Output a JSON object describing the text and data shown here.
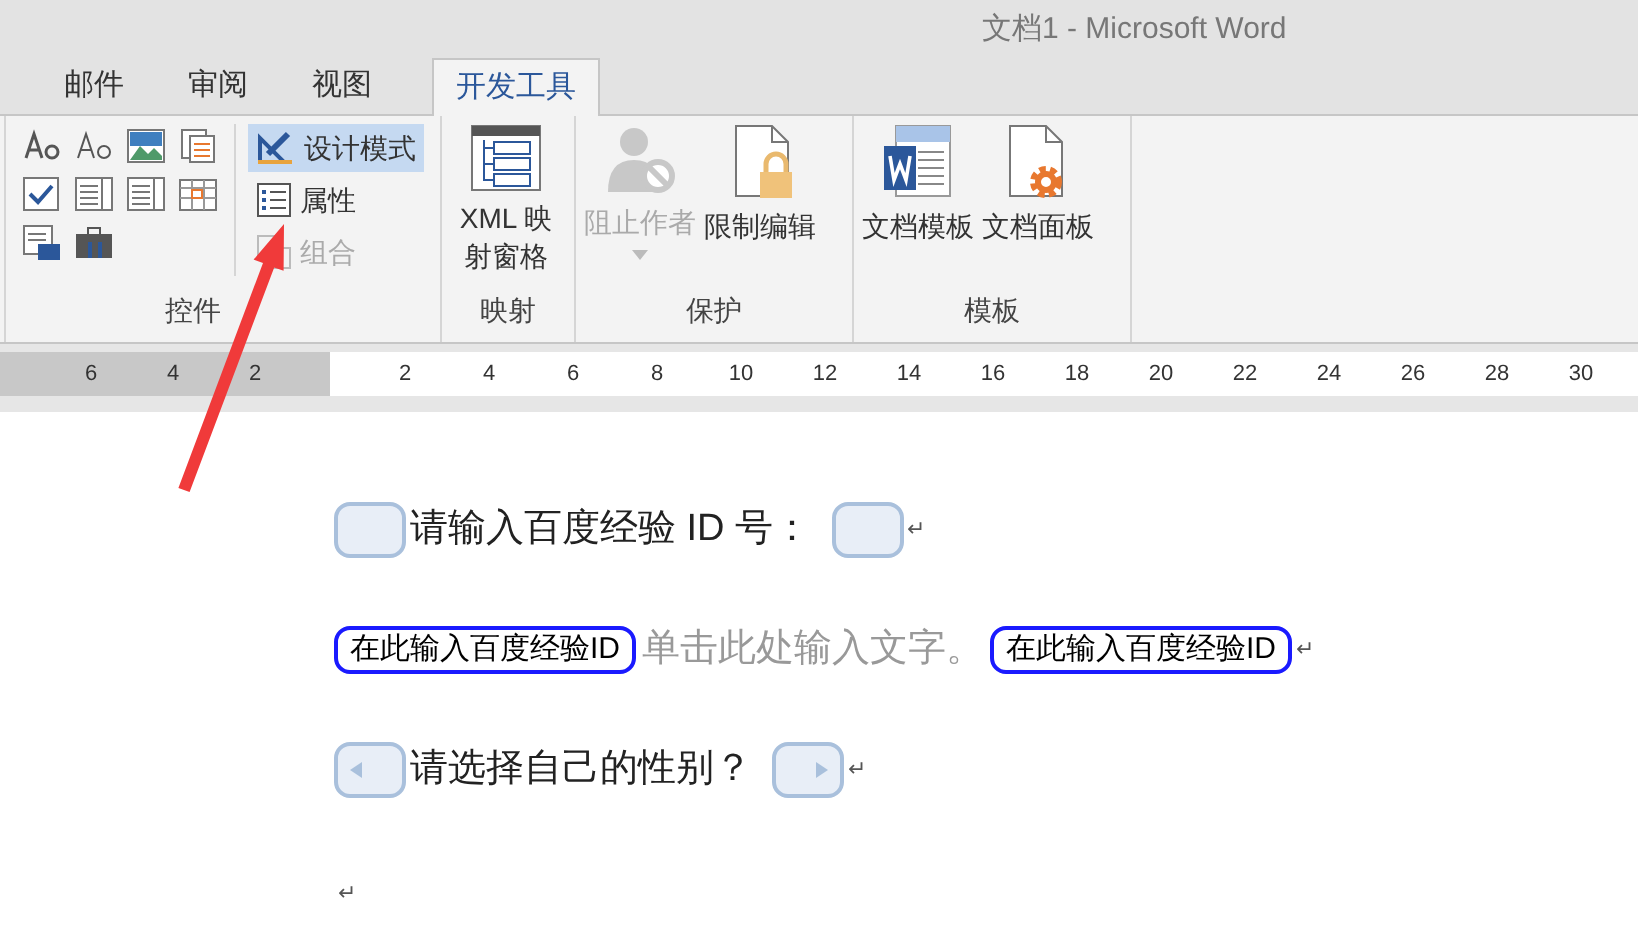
{
  "window": {
    "title": "文档1 - Microsoft Word"
  },
  "tabs": [
    {
      "label": "邮件",
      "selected": false
    },
    {
      "label": "审阅",
      "selected": false
    },
    {
      "label": "视图",
      "selected": false
    },
    {
      "label": "开发工具",
      "selected": true
    }
  ],
  "ribbon": {
    "groups": [
      {
        "label": "控件",
        "items": [
          {
            "label": "设计模式",
            "selected": true,
            "disabled": false
          },
          {
            "label": "属性",
            "selected": false,
            "disabled": false
          },
          {
            "label": "组合",
            "selected": false,
            "disabled": true
          }
        ]
      },
      {
        "label": "映射",
        "items": [
          {
            "label": "XML 映射窗格",
            "disabled": false
          }
        ]
      },
      {
        "label": "保护",
        "items": [
          {
            "label": "阻止作者",
            "disabled": true
          },
          {
            "label": "限制编辑",
            "disabled": false
          }
        ]
      },
      {
        "label": "模板",
        "items": [
          {
            "label": "文档模板",
            "disabled": false
          },
          {
            "label": "文档面板",
            "disabled": false
          }
        ]
      }
    ]
  },
  "ruler": {
    "left_numbers": [
      "6",
      "4",
      "2"
    ],
    "right_numbers": [
      "2",
      "4",
      "6",
      "8",
      "10",
      "12",
      "14",
      "16",
      "18",
      "20",
      "22",
      "24",
      "26",
      "28",
      "30"
    ]
  },
  "document": {
    "paragraphs": [
      {
        "kind": "tagged",
        "text": "请输入百度经验 ID 号：",
        "mark": "↵"
      },
      {
        "kind": "content-control",
        "start_tag": "在此输入百度经验ID",
        "placeholder": "单击此处输入文字。",
        "end_tag": "在此输入百度经验ID",
        "mark": "↵"
      },
      {
        "kind": "tagged-arrows",
        "text": "请选择自己的性别？",
        "mark": "↵"
      },
      {
        "kind": "empty",
        "mark": "↵"
      }
    ]
  }
}
